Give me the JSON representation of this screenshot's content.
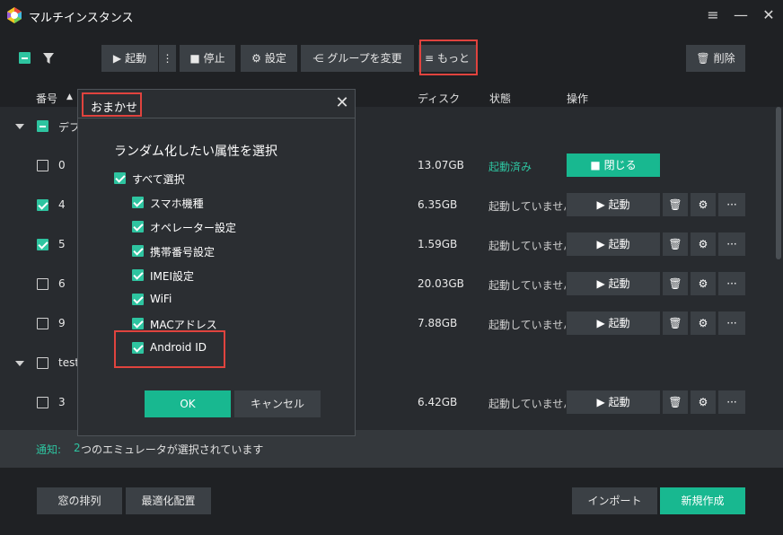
{
  "window": {
    "title": "マルチインスタンス",
    "menu_icon": "hamburger-icon",
    "minimize_icon": "minimize-icon",
    "close_icon": "close-icon"
  },
  "toolbar": {
    "start_label": "起動",
    "stop_label": "停止",
    "settings_label": "設定",
    "change_group_label": "グループを変更",
    "more_label": "もっと",
    "delete_label": "削除"
  },
  "table": {
    "headers": {
      "number": "番号",
      "disk": "ディスク",
      "status": "状態",
      "actions": "操作"
    },
    "groups": [
      {
        "name": "デフ",
        "rows": [
          {
            "id": "0",
            "disk": "13.07GB",
            "status": "起動済み",
            "checked": false,
            "action": "閉じる"
          },
          {
            "id": "4",
            "disk": "6.35GB",
            "status": "起動していません",
            "checked": true,
            "action": "起動"
          },
          {
            "id": "5",
            "disk": "1.59GB",
            "status": "起動していません",
            "checked": true,
            "action": "起動"
          },
          {
            "id": "6",
            "disk": "20.03GB",
            "status": "起動していません",
            "checked": false,
            "action": "起動"
          },
          {
            "id": "9",
            "disk": "7.88GB",
            "status": "起動していません",
            "checked": false,
            "action": "起動"
          }
        ]
      },
      {
        "name": "test",
        "rows": [
          {
            "id": "3",
            "disk": "6.42GB",
            "status": "起動していません",
            "checked": false,
            "action": "起動"
          }
        ]
      }
    ]
  },
  "notice": {
    "label": "通知:",
    "count": "2",
    "text": "つのエミュレータが選択されています"
  },
  "footer": {
    "arrange_label": "窓の排列",
    "optimize_label": "最適化配置",
    "import_label": "インポート",
    "create_label": "新規作成"
  },
  "dialog": {
    "title": "おまかせ",
    "heading": "ランダム化したい属性を選択",
    "select_all": "すべて選択",
    "options": [
      "スマホ機種",
      "オペレーター設定",
      "携帯番号設定",
      "IMEI設定",
      "WiFi",
      "MACアドレス",
      "Android ID"
    ],
    "ok_label": "OK",
    "cancel_label": "キャンセル"
  },
  "colors": {
    "accent": "#18b890",
    "highlight_box": "#e0433e",
    "background": "#1f2124"
  }
}
